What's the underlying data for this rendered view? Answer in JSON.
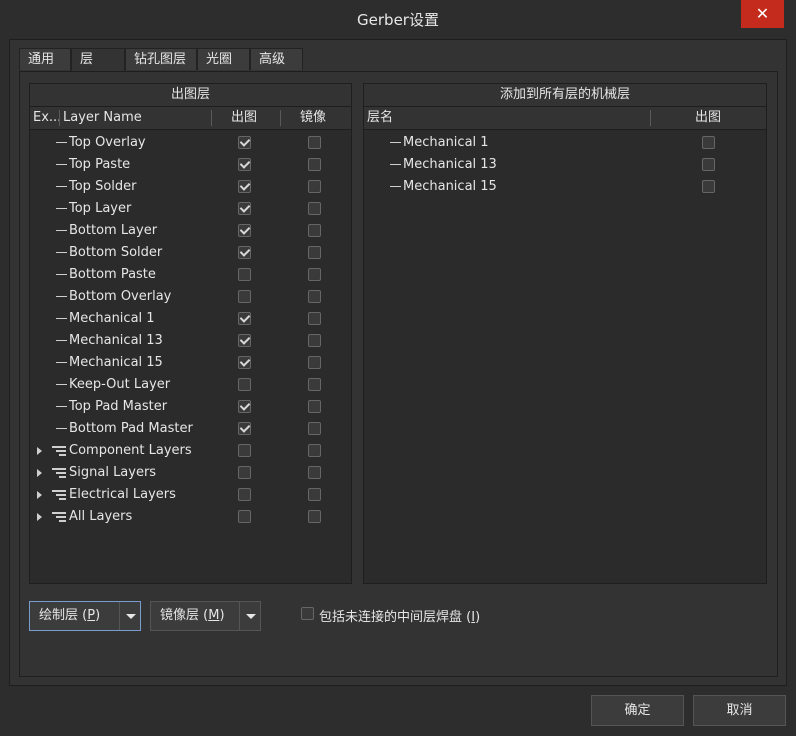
{
  "window": {
    "title": "Gerber设置",
    "close_glyph": "✕"
  },
  "tabs": [
    {
      "label": "通用"
    },
    {
      "label": "层"
    },
    {
      "label": "钻孔图层"
    },
    {
      "label": "光圈"
    },
    {
      "label": "高级"
    }
  ],
  "left_panel": {
    "title": "出图层",
    "columns": {
      "ex": "Ex...",
      "layer_name": "Layer Name",
      "plot": "出图",
      "mirror": "镜像"
    },
    "rows": [
      {
        "name": "Top Overlay",
        "plot": true,
        "mirror": false
      },
      {
        "name": "Top Paste",
        "plot": true,
        "mirror": false
      },
      {
        "name": "Top Solder",
        "plot": true,
        "mirror": false
      },
      {
        "name": "Top Layer",
        "plot": true,
        "mirror": false
      },
      {
        "name": "Bottom Layer",
        "plot": true,
        "mirror": false
      },
      {
        "name": "Bottom Solder",
        "plot": true,
        "mirror": false
      },
      {
        "name": "Bottom Paste",
        "plot": false,
        "mirror": false
      },
      {
        "name": "Bottom Overlay",
        "plot": false,
        "mirror": false
      },
      {
        "name": "Mechanical 1",
        "plot": true,
        "mirror": false
      },
      {
        "name": "Mechanical 13",
        "plot": true,
        "mirror": false
      },
      {
        "name": "Mechanical 15",
        "plot": true,
        "mirror": false
      },
      {
        "name": "Keep-Out Layer",
        "plot": false,
        "mirror": false
      },
      {
        "name": "Top Pad Master",
        "plot": true,
        "mirror": false
      },
      {
        "name": "Bottom Pad Master",
        "plot": true,
        "mirror": false
      }
    ],
    "groups": [
      {
        "name": "Component Layers",
        "plot": false,
        "mirror": false
      },
      {
        "name": "Signal Layers",
        "plot": false,
        "mirror": false
      },
      {
        "name": "Electrical Layers",
        "plot": false,
        "mirror": false
      },
      {
        "name": "All Layers",
        "plot": false,
        "mirror": false
      }
    ]
  },
  "right_panel": {
    "title": "添加到所有层的机械层",
    "columns": {
      "layer_name": "层名",
      "plot": "出图"
    },
    "rows": [
      {
        "name": "Mechanical 1",
        "plot": false
      },
      {
        "name": "Mechanical 13",
        "plot": false
      },
      {
        "name": "Mechanical 15",
        "plot": false
      }
    ]
  },
  "actions": {
    "plot_layers": {
      "label": "绘制层 (",
      "key": "P",
      "close": ")"
    },
    "mirror_layers": {
      "label": "镜像层 (",
      "key": "M",
      "close": ")"
    },
    "include_unconnected": {
      "label": "包括未连接的中间层焊盘 (",
      "key": "I",
      "close": ")",
      "checked": false
    }
  },
  "buttons": {
    "ok": "确定",
    "cancel": "取消"
  }
}
